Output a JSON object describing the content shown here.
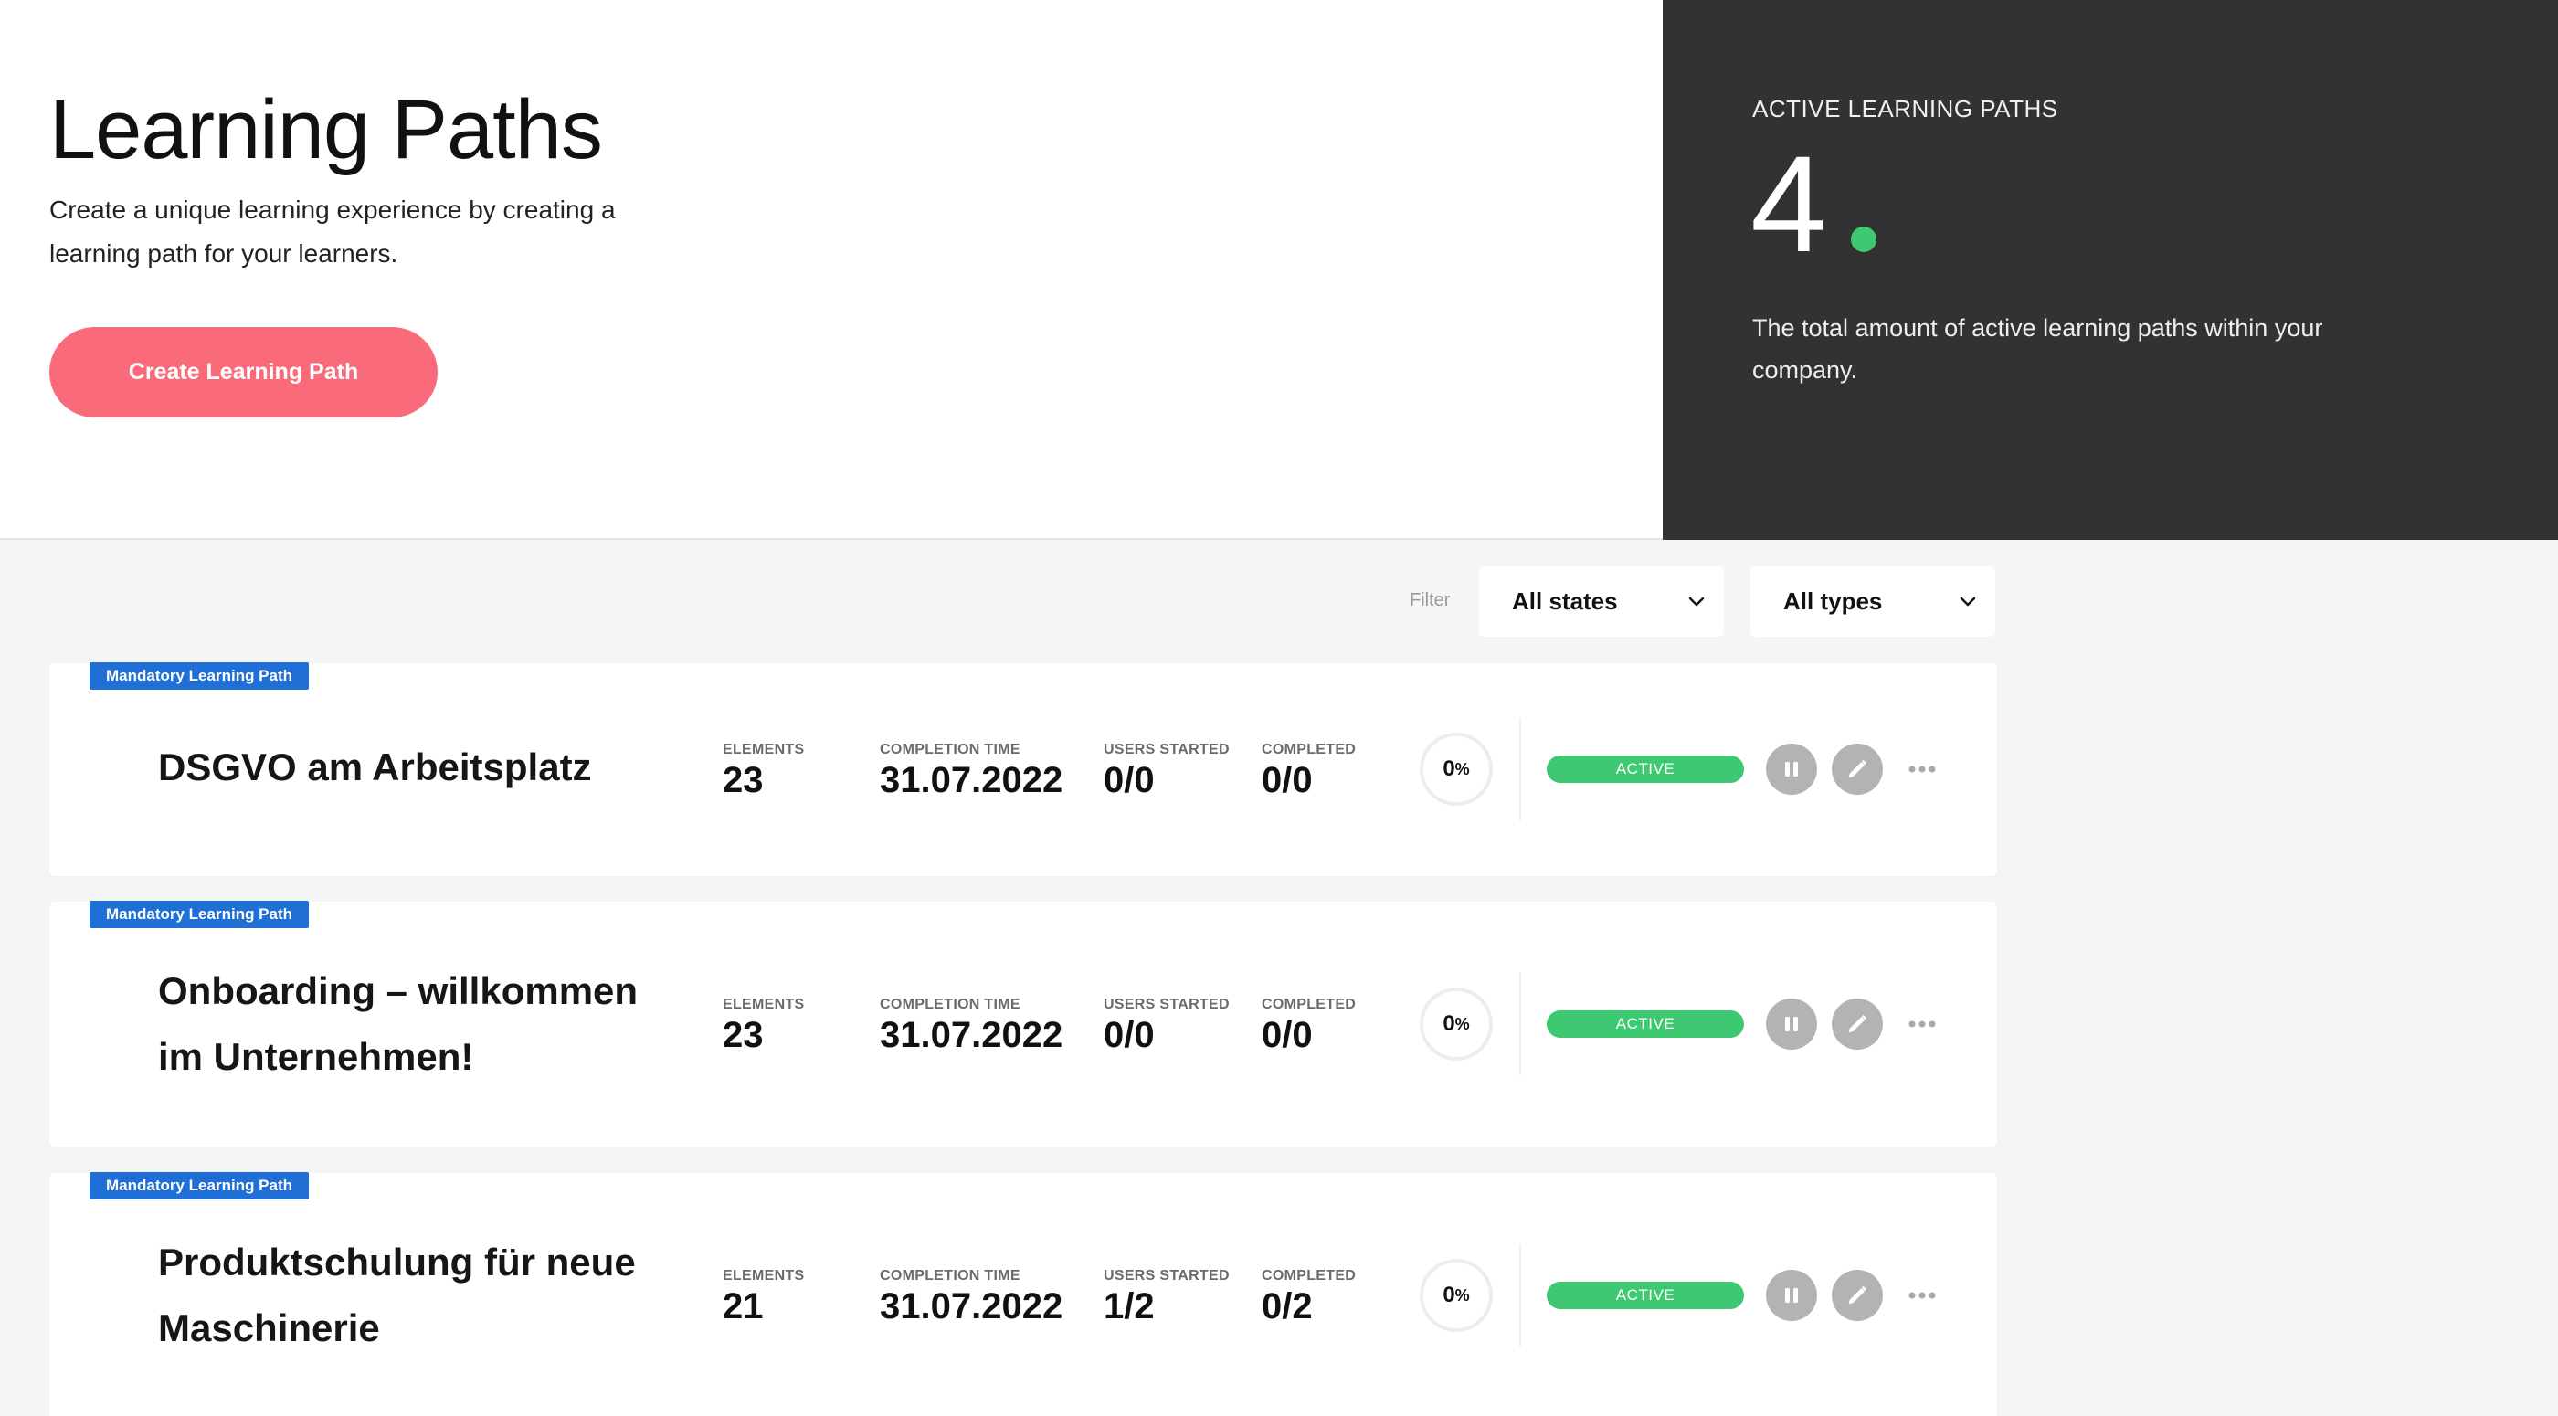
{
  "header": {
    "title": "Learning Paths",
    "description": "Create a unique learning experience by creating a learning path for your learners.",
    "create_button": "Create Learning Path"
  },
  "stats": {
    "label": "ACTIVE LEARNING PATHS",
    "count": "4",
    "dot_color": "#3fc872",
    "description": "The total amount of active learning paths within your company."
  },
  "filters": {
    "label": "Filter",
    "states": "All states",
    "types": "All types"
  },
  "column_labels": {
    "elements": "ELEMENTS",
    "completion_time": "COMPLETION TIME",
    "users_started": "USERS STARTED",
    "completed": "COMPLETED"
  },
  "colors": {
    "accent_button": "#f96b7b",
    "tag": "#1f6fd6",
    "status_active": "#3fc872",
    "dark_panel": "#323232"
  },
  "paths": [
    {
      "tag": "Mandatory Learning Path",
      "title": "DSGVO am Arbeitsplatz",
      "elements": "23",
      "completion_time": "31.07.2022",
      "users_started": "0/0",
      "completed": "0/0",
      "progress_value": "0",
      "progress_unit": "%",
      "status": "ACTIVE"
    },
    {
      "tag": "Mandatory Learning Path",
      "title": "Onboarding – willkommen im Unternehmen!",
      "elements": "23",
      "completion_time": "31.07.2022",
      "users_started": "0/0",
      "completed": "0/0",
      "progress_value": "0",
      "progress_unit": "%",
      "status": "ACTIVE"
    },
    {
      "tag": "Mandatory Learning Path",
      "title": "Produktschulung für neue Maschinerie",
      "elements": "21",
      "completion_time": "31.07.2022",
      "users_started": "1/2",
      "completed": "0/2",
      "progress_value": "0",
      "progress_unit": "%",
      "status": "ACTIVE"
    }
  ],
  "icons": {
    "pause": "pause-icon",
    "edit": "pencil-icon",
    "more": "more-horizontal-icon",
    "dropdown": "chevron-down-icon"
  }
}
